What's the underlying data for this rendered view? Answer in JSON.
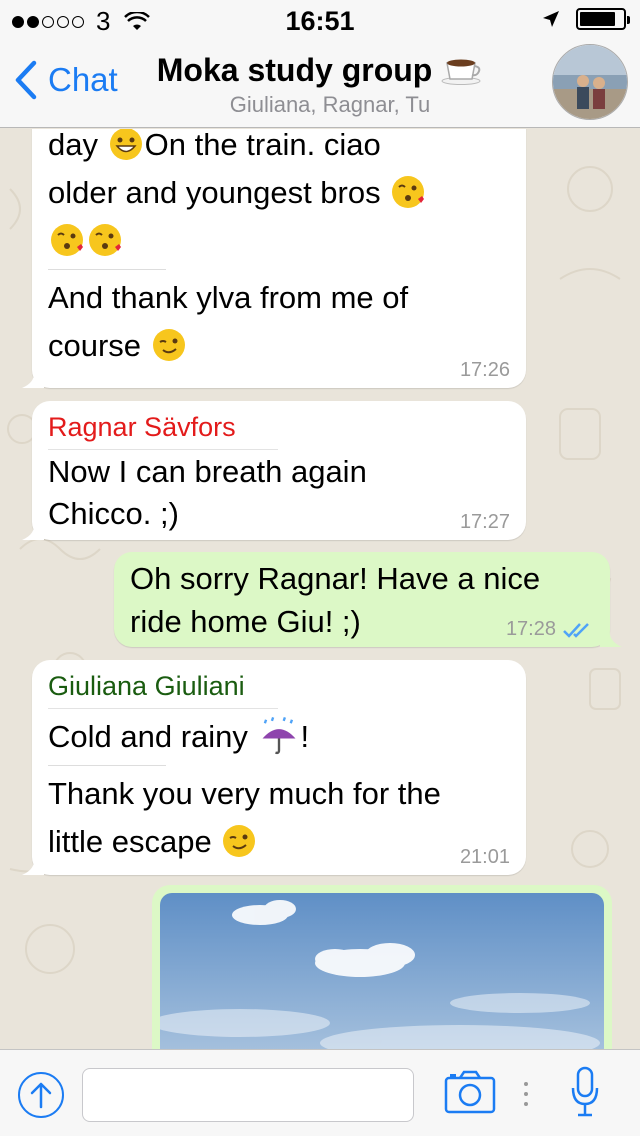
{
  "status_bar": {
    "carrier": "3",
    "time": "16:51"
  },
  "nav": {
    "back_label": "Chat",
    "title": "Moka study group",
    "subtitle": "Giuliana, Ragnar, Tu"
  },
  "messages": [
    {
      "type": "in",
      "lines": [
        "day",
        "On the train.  ciao",
        "older and youngest bros",
        "",
        "And thank ylva from me of",
        "course"
      ],
      "time": "17:26"
    },
    {
      "type": "in",
      "sender": "Ragnar Sävfors",
      "sender_color": "#e31b1b",
      "lines": [
        "Now I can breath again",
        "Chicco. ;)"
      ],
      "time": "17:27"
    },
    {
      "type": "out",
      "lines": [
        "Oh sorry Ragnar! Have a nice",
        "ride home Giu! ;)"
      ],
      "time": "17:28"
    },
    {
      "type": "in",
      "sender": "Giuliana Giuliani",
      "sender_color": "#1a5c10",
      "lines": [
        "Cold and rainy",
        "!",
        "Thank you very much for the",
        "little escape"
      ],
      "time": "21:01"
    }
  ],
  "input": {
    "placeholder": ""
  },
  "colors": {
    "accent": "#1b7cf3",
    "outgoing_bubble": "#dcf8c6",
    "incoming_bubble": "#ffffff",
    "read_ticks": "#4fa3f7"
  },
  "icons": [
    "signal-dots-icon",
    "wifi-icon",
    "location-arrow-icon",
    "battery-icon",
    "back-chevron-icon",
    "coffee-cup-icon",
    "group-avatar",
    "grinning-face-icon",
    "kissing-face-icon",
    "winking-face-icon",
    "umbrella-rain-icon",
    "read-ticks-icon",
    "upload-arrow-icon",
    "camera-icon",
    "microphone-icon"
  ]
}
